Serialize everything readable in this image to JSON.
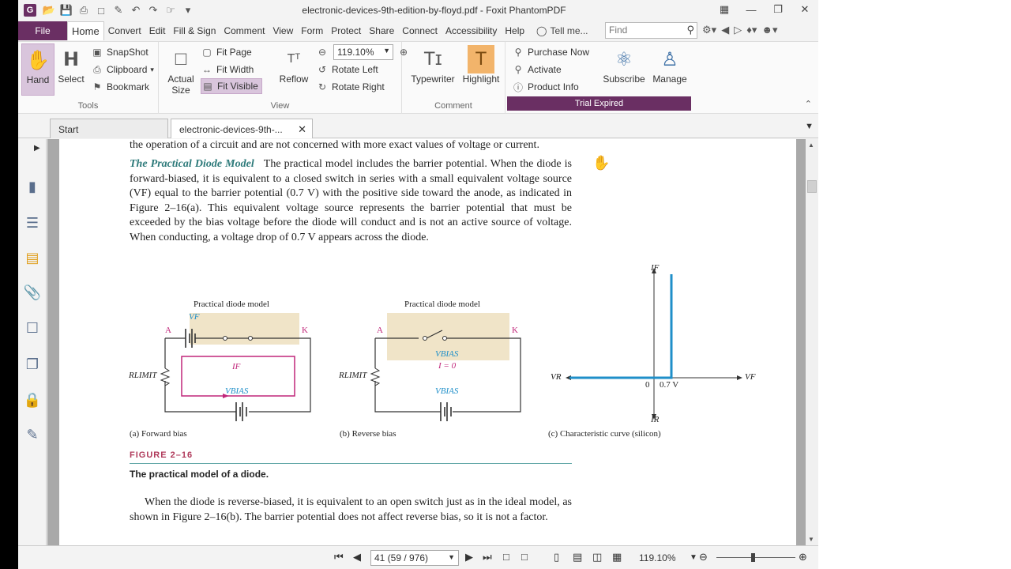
{
  "window": {
    "title": "electronic-devices-9th-edition-by-floyd.pdf - Foxit PhantomPDF",
    "logo_letter": "G"
  },
  "menubar": {
    "file": "File",
    "items": [
      "Home",
      "Convert",
      "Edit",
      "Fill & Sign",
      "Comment",
      "View",
      "Form",
      "Protect",
      "Share",
      "Connect",
      "Accessibility",
      "Help"
    ],
    "tell_me": "Tell me...",
    "find_placeholder": "Find"
  },
  "ribbon": {
    "tools": {
      "hand": "Hand",
      "select": "Select",
      "snapshot": "SnapShot",
      "clipboard": "Clipboard",
      "bookmark": "Bookmark",
      "label": "Tools"
    },
    "view": {
      "actual_size_1": "Actual",
      "actual_size_2": "Size",
      "fit_page": "Fit Page",
      "fit_width": "Fit Width",
      "fit_visible": "Fit Visible",
      "reflow": "Reflow",
      "zoom": "119.10%",
      "rotate_left": "Rotate Left",
      "rotate_right": "Rotate Right",
      "label": "View"
    },
    "comment": {
      "typewriter": "Typewriter",
      "highlight": "Highlight",
      "label": "Comment"
    },
    "purchase": {
      "purchase_now": "Purchase Now",
      "activate": "Activate",
      "product_info": "Product Info",
      "subscribe": "Subscribe",
      "manage": "Manage",
      "trial": "Trial Expired"
    }
  },
  "tabs": {
    "start": "Start",
    "document": "electronic-devices-9th-..."
  },
  "document": {
    "line_top": "the operation of a circuit and are not concerned with more exact values of voltage or current.",
    "heading": "The Practical Diode Model",
    "para1": "The practical model includes the barrier potential. When the diode is forward-biased, it is equivalent to a closed switch in series with a small equivalent voltage source (VF) equal to the barrier potential (0.7 V) with the positive side toward the anode, as indicated in Figure 2–16(a). This equivalent voltage source represents the barrier potential that must be exceeded by the bias voltage before the diode will conduct and is not an active source of voltage. When conducting, a voltage drop of 0.7 V appears across the diode.",
    "fig_a_title": "Practical diode model",
    "fig_b_title": "Practical diode model",
    "label_A": "A",
    "label_K": "K",
    "label_VF": "VF",
    "label_IF": "IF",
    "label_VBIAS": "VBIAS",
    "label_RLIMIT": "RLIMIT",
    "label_I0": "I = 0",
    "label_07V": "0.7 V",
    "label_0": "0",
    "label_VR": "VR",
    "label_IR": "IR",
    "caption_a": "(a) Forward bias",
    "caption_b": "(b) Reverse bias",
    "caption_c": "(c) Characteristic curve (silicon)",
    "figure_title": "FIGURE 2–16",
    "figure_caption": "The practical model of a diode.",
    "para2": "When the diode is reverse-biased, it is equivalent to an open switch just as in the ideal model, as shown in Figure 2–16(b). The barrier potential does not affect reverse bias, so it is not a factor."
  },
  "statusbar": {
    "page": "41 (59 / 976)",
    "zoom": "119.10%"
  },
  "colors": {
    "brand": "#6a2f63",
    "curve": "#1f8fc9",
    "current_path": "#c0267a",
    "shade": "#f0e4c8"
  }
}
